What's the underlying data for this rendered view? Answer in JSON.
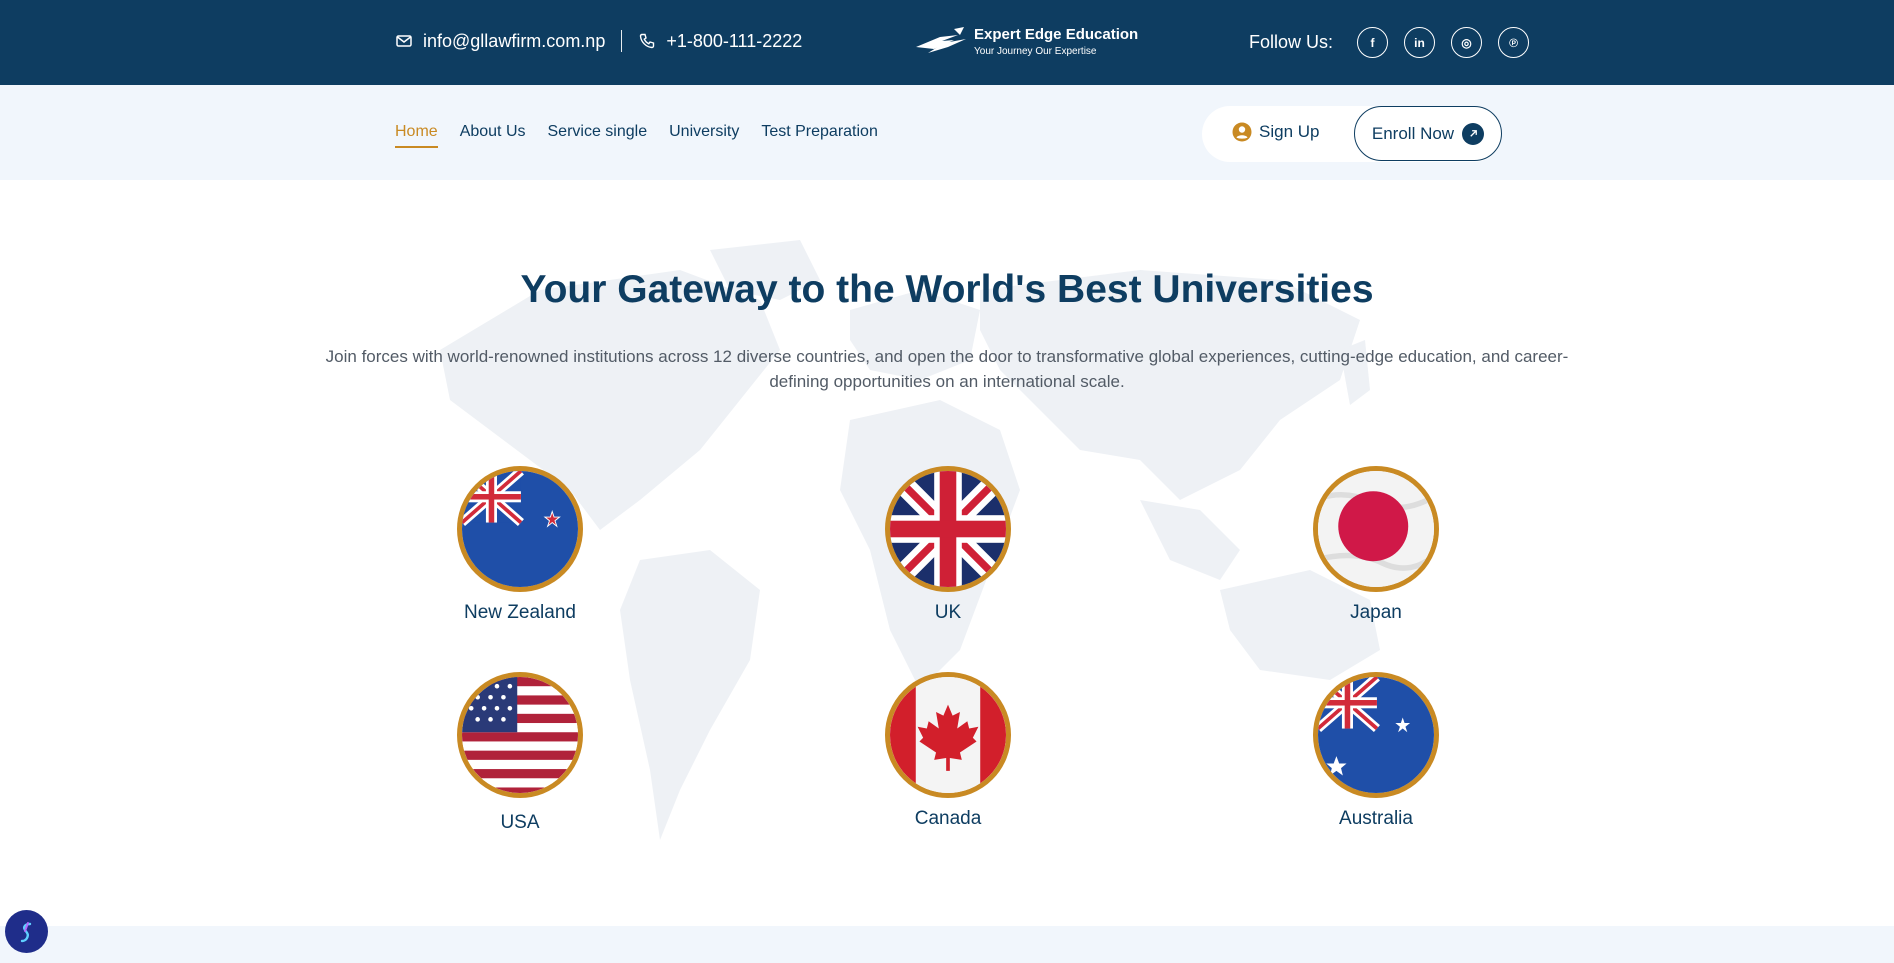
{
  "topbar": {
    "email": "info@gllawfirm.com.np",
    "phone": "+1-800-111-2222",
    "follow_label": "Follow Us:",
    "social": [
      {
        "icon": "facebook-icon",
        "glyph": "f"
      },
      {
        "icon": "linkedin-icon",
        "glyph": "in"
      },
      {
        "icon": "instagram-icon",
        "glyph": "◎"
      },
      {
        "icon": "pinterest-icon",
        "glyph": "℗"
      }
    ]
  },
  "logo": {
    "name": "Expert Edge Education",
    "tagline": "Your Journey Our Expertise"
  },
  "nav": {
    "items": [
      "Home",
      "About Us",
      "Service single",
      "University",
      "Test Preparation"
    ],
    "active": "Home"
  },
  "actions": {
    "signup": "Sign Up",
    "enroll": "Enroll Now"
  },
  "hero": {
    "title": "Your Gateway to the World's Best Universities",
    "description": "Join forces with world-renowned institutions across 12 diverse countries, and open the door to transformative global experiences, cutting-edge education, and career-defining opportunities on an international scale."
  },
  "countries": [
    {
      "name": "New Zealand",
      "flag": "new-zealand-flag-icon"
    },
    {
      "name": "UK",
      "flag": "uk-flag-icon"
    },
    {
      "name": "Japan",
      "flag": "japan-flag-icon"
    },
    {
      "name": "USA",
      "flag": "usa-flag-icon"
    },
    {
      "name": "Canada",
      "flag": "canada-flag-icon"
    },
    {
      "name": "Australia",
      "flag": "australia-flag-icon"
    }
  ],
  "colors": {
    "primary": "#0e3d61",
    "accent": "#c98a23",
    "nav_bg": "#f1f6fc"
  }
}
